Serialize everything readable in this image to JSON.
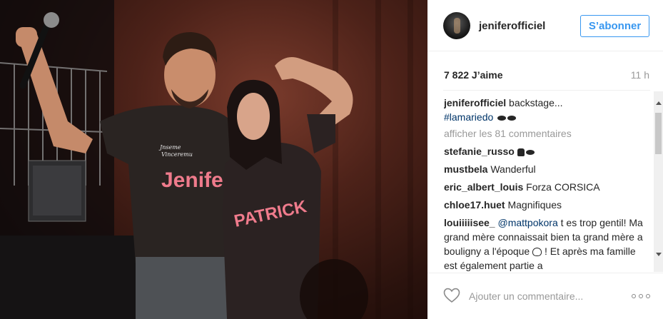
{
  "post": {
    "username": "jeniferofficiel",
    "follow_label": "S’abonner",
    "likes": "7 822 J’aime",
    "time": "11 h",
    "caption_text": "backstage...",
    "caption_hashtag": "#lamariedo",
    "view_all_comments": "afficher les 81 commentaires",
    "comments": [
      {
        "user": "stefanie_russo",
        "text": ""
      },
      {
        "user": "mustbela",
        "text": "Wanderful"
      },
      {
        "user": "eric_albert_louis",
        "text": "Forza CORSICA"
      },
      {
        "user": "chloe17.huet",
        "text": "Magnifiques"
      }
    ],
    "long_comment": {
      "user": "louiiiiisee_",
      "mention": "@mattpokora",
      "text_1": "t es trop gentil! Ma grand mère connaissait bien ta grand mère a bouligny a l'époque",
      "text_2": "! Et après ma famille est également partie a"
    },
    "comment_placeholder": "Ajouter un commentaire...",
    "colors": {
      "accent": "#3897f0",
      "hashtag": "#003569",
      "muted": "#999999"
    }
  },
  "photo": {
    "shirt_left_text": "Jenifer",
    "shirt_right_text": "PATRICK",
    "shirt_small_text_1": "Jnseme",
    "shirt_small_text_2": "Vinceremu"
  },
  "icons": {
    "heart": "heart-outline-icon",
    "more": "more-options-icon",
    "emoji": "kiss-lips-icon"
  }
}
